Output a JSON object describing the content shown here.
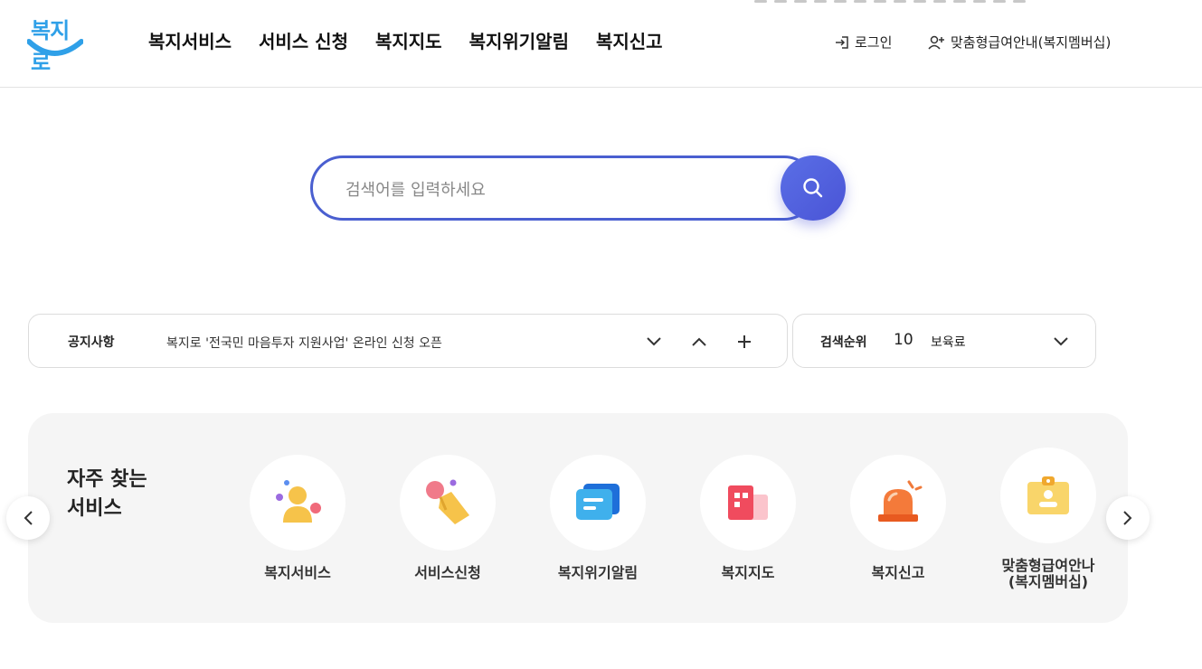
{
  "header": {
    "logo_text": "복지로",
    "nav": [
      "복지서비스",
      "서비스 신청",
      "복지지도",
      "복지위기알림",
      "복지신고"
    ],
    "login": "로그인",
    "membership": "맞춤형급여안내(복지멤버십)"
  },
  "search": {
    "placeholder": "검색어를 입력하세요"
  },
  "notice": {
    "label": "공지사항",
    "text": "복지로 '전국민 마음투자 지원사업' 온라인 신청 오픈"
  },
  "rank": {
    "label": "검색순위",
    "number": "10",
    "keyword": "보육료"
  },
  "frequent": {
    "title": "자주 찾는\n서비스",
    "items": [
      {
        "label": "복지서비스",
        "icon": "person-icon"
      },
      {
        "label": "서비스신청",
        "icon": "hand-touch-icon"
      },
      {
        "label": "복지위기알림",
        "icon": "message-icon"
      },
      {
        "label": "복지지도",
        "icon": "map-building-icon"
      },
      {
        "label": "복지신고",
        "icon": "siren-icon"
      },
      {
        "label": "맞춤형급여안나\n(복지멤버십)",
        "icon": "id-card-icon"
      }
    ]
  },
  "colors": {
    "brand_blue": "#2fa0e8",
    "search_border": "#4a5fd0",
    "search_button": "#5a6fe6"
  }
}
